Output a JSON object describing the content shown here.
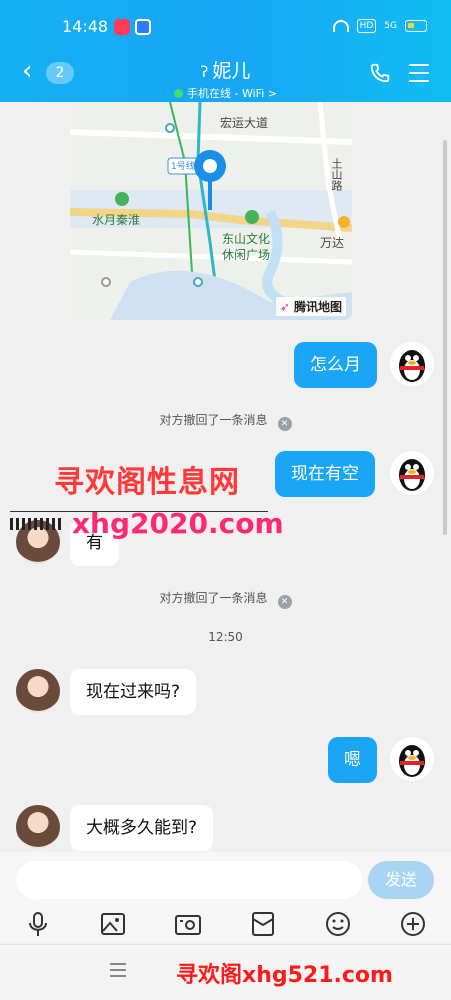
{
  "status_bar": {
    "time": "14:48",
    "hd_label": "HD",
    "signal_label": "5G"
  },
  "header": {
    "back_badge": "2",
    "title": "妮儿",
    "subtitle": "手机在线 - WiFi >"
  },
  "map": {
    "labels": [
      "宏运大道",
      "1号线",
      "水月秦淮",
      "东山文化",
      "休闲广场",
      "万达",
      "土山路"
    ],
    "credit": "腾讯地图"
  },
  "messages": [
    {
      "side": "out",
      "text": "怎么月"
    },
    {
      "type": "system",
      "text": "对方撤回了一条消息"
    },
    {
      "side": "out",
      "text": "现在有空"
    },
    {
      "side": "in",
      "text": "有"
    },
    {
      "type": "system",
      "text": "对方撤回了一条消息"
    },
    {
      "type": "time",
      "text": "12:50"
    },
    {
      "side": "in",
      "text": "现在过来吗?"
    },
    {
      "side": "out",
      "text": "嗯"
    },
    {
      "side": "in",
      "text": "大概多久能到?"
    }
  ],
  "watermarks": {
    "top": "寻欢阁性息网",
    "url": "xhg2020.com",
    "bottom": "寻欢阁xhg521.com"
  },
  "input": {
    "placeholder": "",
    "send_label": "发送"
  },
  "toolbar_icons": [
    "microphone-icon",
    "image-icon",
    "camera-icon",
    "red-packet-icon",
    "emoji-icon",
    "plus-icon"
  ],
  "colors": {
    "header": "#18a6f5",
    "bubble_out": "#1aa5f5",
    "send_disabled": "#a9d4f2"
  }
}
